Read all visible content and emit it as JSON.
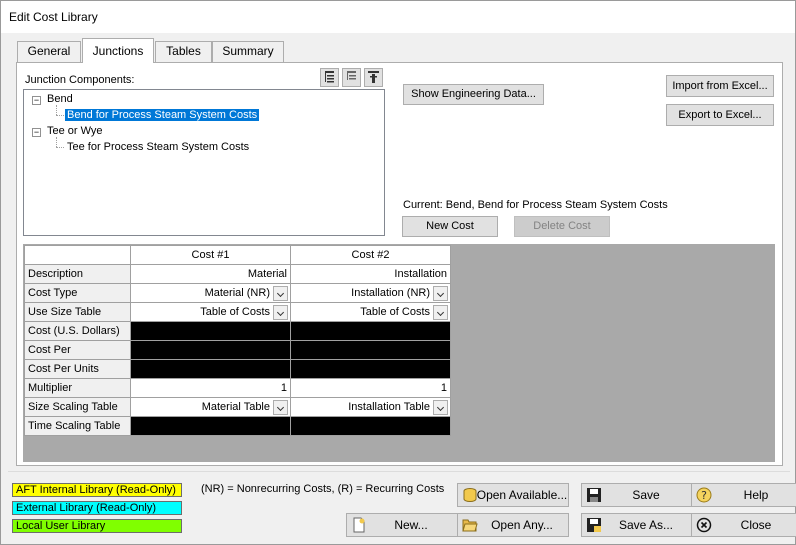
{
  "window": {
    "title": "Edit Cost Library"
  },
  "tabs": [
    {
      "label": "General"
    },
    {
      "label": "Junctions"
    },
    {
      "label": "Tables"
    },
    {
      "label": "Summary"
    }
  ],
  "junction_components_label": "Junction Components:",
  "tree": {
    "items": [
      {
        "label": "Bend"
      },
      {
        "label": "Bend for Process Steam System Costs"
      },
      {
        "label": "Tee or Wye"
      },
      {
        "label": "Tee for Process Steam System Costs"
      }
    ]
  },
  "buttons": {
    "show_engineering": "Show Engineering Data...",
    "import_excel": "Import from Excel...",
    "export_excel": "Export to Excel...",
    "new_cost": "New Cost",
    "delete_cost": "Delete Cost",
    "open_available": "Open Available...",
    "save": "Save",
    "help": "Help",
    "new": "New...",
    "open_any": "Open Any...",
    "save_as": "Save As...",
    "close": "Close"
  },
  "current_label": "Current: Bend, Bend for Process Steam System Costs",
  "grid": {
    "columns": [
      "Cost #1",
      "Cost #2"
    ],
    "rows": [
      {
        "label": "Description",
        "c1": "Material",
        "c2": "Installation"
      },
      {
        "label": "Cost Type",
        "c1": "Material (NR)",
        "c2": "Installation (NR)"
      },
      {
        "label": "Use Size Table",
        "c1": "Table of Costs",
        "c2": "Table of Costs"
      },
      {
        "label": "Cost (U.S. Dollars)",
        "c1": "",
        "c2": ""
      },
      {
        "label": "Cost Per",
        "c1": "",
        "c2": ""
      },
      {
        "label": "Cost Per Units",
        "c1": "",
        "c2": ""
      },
      {
        "label": "Multiplier",
        "c1": "1",
        "c2": "1"
      },
      {
        "label": "Size Scaling Table",
        "c1": "Material Table",
        "c2": "Installation Table"
      },
      {
        "label": "Time Scaling Table",
        "c1": "",
        "c2": ""
      }
    ]
  },
  "legend": {
    "aft_internal": {
      "label": "AFT Internal Library (Read-Only)",
      "color": "#ffff00"
    },
    "external": {
      "label": "External Library (Read-Only)",
      "color": "#00ffff"
    },
    "local_user": {
      "label": "Local User Library",
      "color": "#80ff00"
    }
  },
  "note": "(NR) = Nonrecurring Costs, (R) = Recurring Costs",
  "colors": {
    "selection": "#0078d7",
    "grid_bg": "#a9a9a9"
  }
}
